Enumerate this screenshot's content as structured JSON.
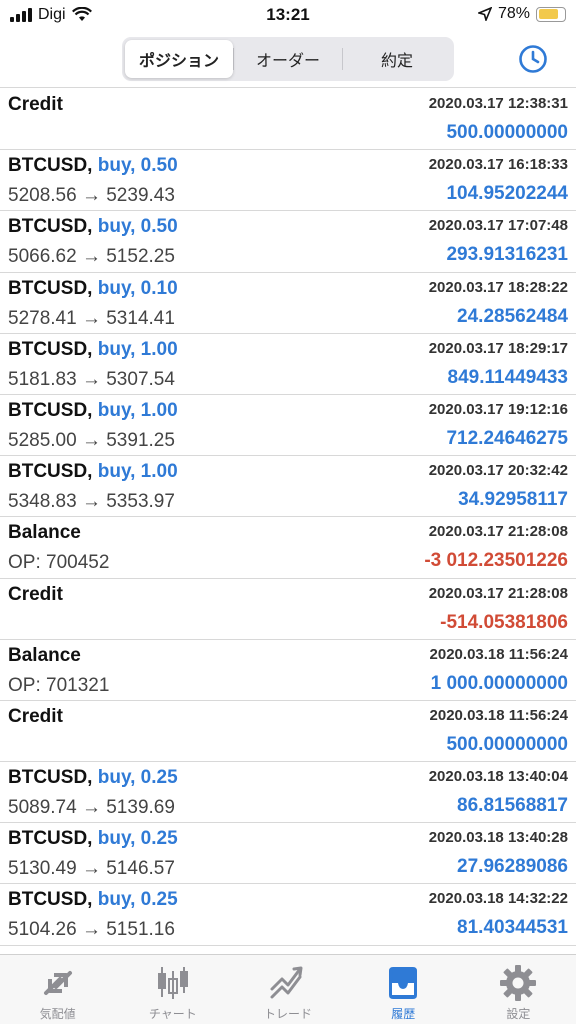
{
  "status": {
    "carrier": "Digi",
    "time": "13:21",
    "battery": "78%",
    "battery_level": 0.78
  },
  "header": {
    "tabs": [
      {
        "label": "ポジション",
        "active": true
      },
      {
        "label": "オーダー",
        "active": false
      },
      {
        "label": "約定",
        "active": false
      }
    ],
    "clock_icon": "clock-icon"
  },
  "rows": [
    {
      "title": "Credit",
      "action": "",
      "date": "2020.03.17 12:38:31",
      "sub": "",
      "profit": "500.00000000",
      "negative": false
    },
    {
      "title": "BTCUSD,",
      "action": "buy, 0.50",
      "date": "2020.03.17 16:18:33",
      "sub": "5208.56 → 5239.43",
      "profit": "104.95202244",
      "negative": false
    },
    {
      "title": "BTCUSD,",
      "action": "buy, 0.50",
      "date": "2020.03.17 17:07:48",
      "sub": "5066.62 → 5152.25",
      "profit": "293.91316231",
      "negative": false
    },
    {
      "title": "BTCUSD,",
      "action": "buy, 0.10",
      "date": "2020.03.17 18:28:22",
      "sub": "5278.41 → 5314.41",
      "profit": "24.28562484",
      "negative": false
    },
    {
      "title": "BTCUSD,",
      "action": "buy, 1.00",
      "date": "2020.03.17 18:29:17",
      "sub": "5181.83 → 5307.54",
      "profit": "849.11449433",
      "negative": false
    },
    {
      "title": "BTCUSD,",
      "action": "buy, 1.00",
      "date": "2020.03.17 19:12:16",
      "sub": "5285.00 → 5391.25",
      "profit": "712.24646275",
      "negative": false
    },
    {
      "title": "BTCUSD,",
      "action": "buy, 1.00",
      "date": "2020.03.17 20:32:42",
      "sub": "5348.83 → 5353.97",
      "profit": "34.92958117",
      "negative": false
    },
    {
      "title": "Balance",
      "action": "",
      "date": "2020.03.17 21:28:08",
      "sub": "OP: 700452",
      "profit": "-3 012.23501226",
      "negative": true
    },
    {
      "title": "Credit",
      "action": "",
      "date": "2020.03.17 21:28:08",
      "sub": "",
      "profit": "-514.05381806",
      "negative": true
    },
    {
      "title": "Balance",
      "action": "",
      "date": "2020.03.18 11:56:24",
      "sub": "OP: 701321",
      "profit": "1 000.00000000",
      "negative": false
    },
    {
      "title": "Credit",
      "action": "",
      "date": "2020.03.18 11:56:24",
      "sub": "",
      "profit": "500.00000000",
      "negative": false
    },
    {
      "title": "BTCUSD,",
      "action": "buy, 0.25",
      "date": "2020.03.18 13:40:04",
      "sub": "5089.74 → 5139.69",
      "profit": "86.81568817",
      "negative": false
    },
    {
      "title": "BTCUSD,",
      "action": "buy, 0.25",
      "date": "2020.03.18 13:40:28",
      "sub": "5130.49 → 5146.57",
      "profit": "27.96289086",
      "negative": false
    },
    {
      "title": "BTCUSD,",
      "action": "buy, 0.25",
      "date": "2020.03.18 14:32:22",
      "sub": "5104.26 → 5151.16",
      "profit": "81.40344531",
      "negative": false
    }
  ],
  "tabbar": [
    {
      "label": "気配値",
      "icon": "quotes-icon",
      "active": false
    },
    {
      "label": "チャート",
      "icon": "chart-icon",
      "active": false
    },
    {
      "label": "トレード",
      "icon": "trade-icon",
      "active": false
    },
    {
      "label": "履歴",
      "icon": "history-icon",
      "active": true
    },
    {
      "label": "設定",
      "icon": "settings-icon",
      "active": false
    }
  ],
  "colors": {
    "accent": "#2f7ad6",
    "negative": "#d14b36"
  }
}
